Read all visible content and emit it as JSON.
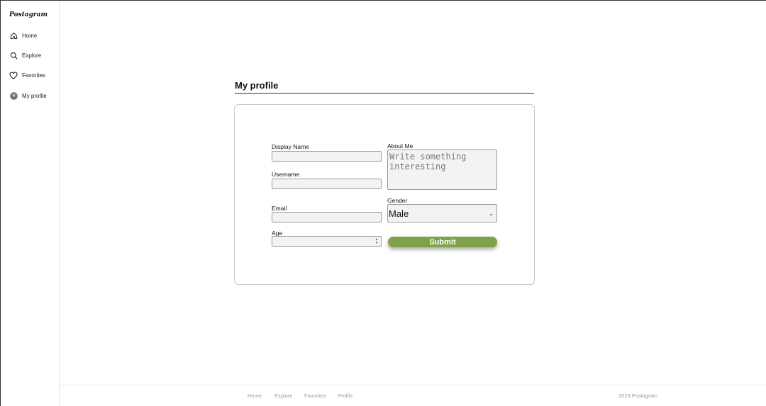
{
  "brand": "Postagram",
  "sidebar": {
    "items": [
      {
        "label": "Home",
        "icon": "home-icon"
      },
      {
        "label": "Explore",
        "icon": "search-icon"
      },
      {
        "label": "Favorites",
        "icon": "heart-icon"
      },
      {
        "label": "My profile",
        "icon": "avatar"
      }
    ]
  },
  "main": {
    "title": "My profile",
    "form": {
      "display_name_label": "Display Name",
      "display_name_value": "",
      "username_label": "Username",
      "username_value": "",
      "email_label": "Email",
      "email_value": "",
      "age_label": "Age",
      "age_value": "",
      "about_label": "About Me",
      "about_placeholder": "Write something interesting",
      "gender_label": "Gender",
      "gender_value": "Male",
      "submit_label": "Submit"
    }
  },
  "footer": {
    "links": [
      "Home",
      "Explore",
      "Favorites",
      "Profile"
    ],
    "copyright": "2023 Postagram"
  },
  "colors": {
    "accent": "#7fa14a",
    "field_bg": "#f3f3f3",
    "muted_text": "#9a9a9a"
  }
}
